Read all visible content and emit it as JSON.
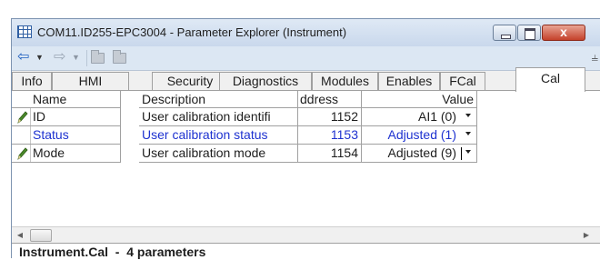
{
  "window": {
    "title": "COM11.ID255-EPC3004 - Parameter Explorer (Instrument)",
    "close_symbol": "x"
  },
  "toolbar": {
    "back_icon": "arrow-left-icon",
    "forward_icon": "arrow-right-icon",
    "pin_icon": "pushpin-icon"
  },
  "tabs": [
    "Info",
    "HMI",
    "Security",
    "Diagnostics",
    "Modules",
    "Enables",
    "FCal",
    "Cal"
  ],
  "active_tab": "Cal",
  "table": {
    "columns": [
      "Name",
      "Description",
      "Address",
      "Value"
    ],
    "column_header_visible": [
      "Name",
      "Description",
      "ddress",
      "Value"
    ],
    "rows": [
      {
        "editable": true,
        "name": "ID",
        "description": "User calibration identifi",
        "address": "1152",
        "value": "AI1 (0)",
        "color": "#1e1e1e"
      },
      {
        "editable": false,
        "name": "Status",
        "description": "User calibration status",
        "address": "1153",
        "value": "Adjusted (1)",
        "color": "#1e32d0"
      },
      {
        "editable": true,
        "name": "Mode",
        "description": "User calibration mode",
        "address": "1154",
        "value": "Adjusted (9)",
        "color": "#1e1e1e"
      }
    ]
  },
  "status": {
    "text": "Instrument.Cal  -  4 parameters"
  }
}
